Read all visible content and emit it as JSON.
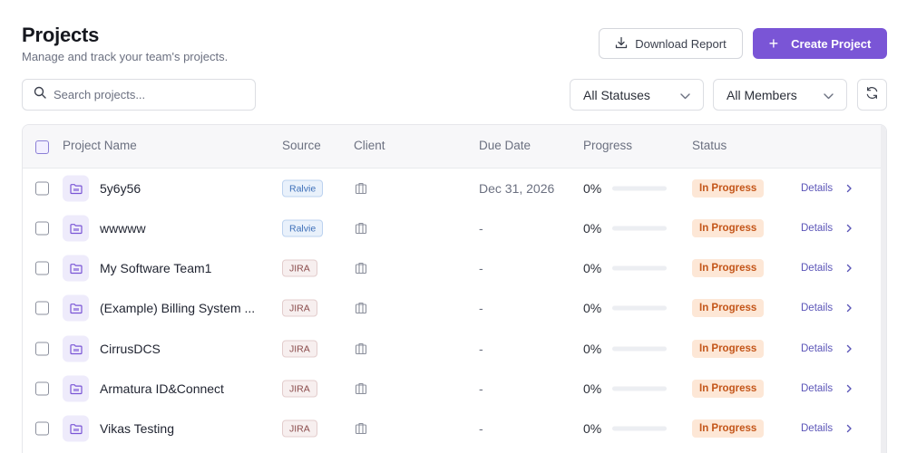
{
  "header": {
    "title": "Projects",
    "subtitle": "Manage and track your team's projects.",
    "download_label": "Download Report",
    "create_label": "Create Project"
  },
  "filters": {
    "search_placeholder": "Search projects...",
    "status_value": "All Statuses",
    "members_value": "All Members"
  },
  "table": {
    "columns": {
      "name": "Project Name",
      "source": "Source",
      "client": "Client",
      "due": "Due Date",
      "progress": "Progress",
      "status": "Status"
    },
    "rows": [
      {
        "name": "5y6y56",
        "source": "Ralvie",
        "due": "Dec 31, 2026",
        "progress_label": "0%",
        "progress": 0,
        "status": "In Progress",
        "details": "Details"
      },
      {
        "name": "wwwww",
        "source": "Ralvie",
        "due": "-",
        "progress_label": "0%",
        "progress": 0,
        "status": "In Progress",
        "details": "Details"
      },
      {
        "name": "My Software Team1",
        "source": "JIRA",
        "due": "-",
        "progress_label": "0%",
        "progress": 0,
        "status": "In Progress",
        "details": "Details"
      },
      {
        "name": "(Example) Billing System ...",
        "source": "JIRA",
        "due": "-",
        "progress_label": "0%",
        "progress": 0,
        "status": "In Progress",
        "details": "Details"
      },
      {
        "name": "CirrusDCS",
        "source": "JIRA",
        "due": "-",
        "progress_label": "0%",
        "progress": 0,
        "status": "In Progress",
        "details": "Details"
      },
      {
        "name": "Armatura ID&Connect",
        "source": "JIRA",
        "due": "-",
        "progress_label": "0%",
        "progress": 0,
        "status": "In Progress",
        "details": "Details"
      },
      {
        "name": "Vikas Testing",
        "source": "JIRA",
        "due": "-",
        "progress_label": "0%",
        "progress": 0,
        "status": "In Progress",
        "details": "Details"
      }
    ]
  },
  "colors": {
    "accent": "#7a55d6",
    "status_bg": "#fde7d6",
    "status_text": "#c4561a"
  },
  "icons": {
    "download": "download-icon",
    "plus": "plus-icon",
    "search": "search-icon",
    "chevron": "chevron-down-icon",
    "refresh": "refresh-icon",
    "project": "folder-icon",
    "client": "building-icon",
    "row_chevron": "chevron-right-icon"
  }
}
